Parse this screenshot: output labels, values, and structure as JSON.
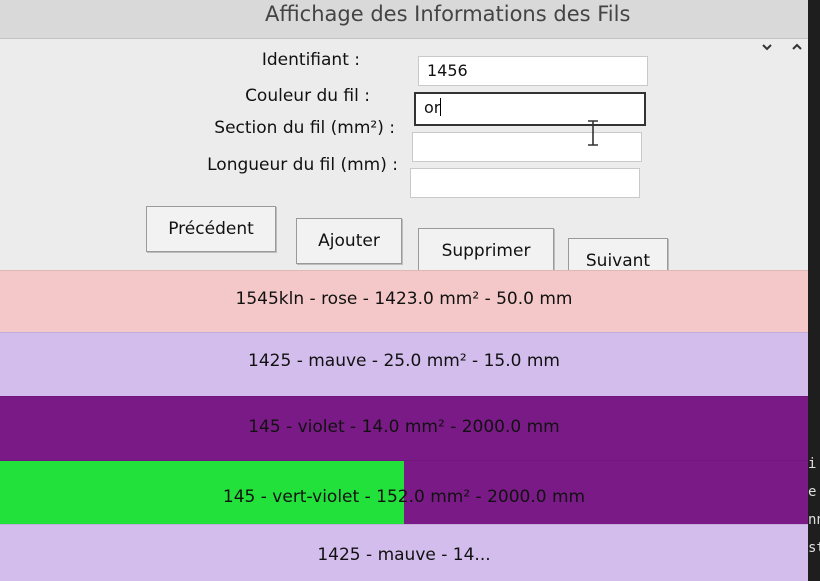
{
  "window": {
    "title": "Affichage des Informations des Fils",
    "controls": {
      "minimize_icon": "chevron-down-icon",
      "maximize_icon": "chevron-up-icon"
    }
  },
  "form": {
    "id_label": "Identifiant :",
    "id_value": "1456",
    "color_label": "Couleur du fil :",
    "color_value": "or",
    "section_label": "Section du fil (mm²) :",
    "section_value": "",
    "length_label": "Longueur du fil (mm) :",
    "length_value": ""
  },
  "buttons": {
    "previous": "Précédent",
    "add": "Ajouter",
    "delete": "Supprimer",
    "next": "Suivant"
  },
  "wires": [
    {
      "text": "1545kln - rose - 1423.0 mm² - 50.0 mm",
      "color": "#f4c8c8",
      "text_color": "#111111"
    },
    {
      "text": "1425 - mauve - 25.0 mm² - 15.0 mm",
      "color": "#d3bdec",
      "text_color": "#111111"
    },
    {
      "text": "145 - violet - 14.0 mm² - 2000.0 mm",
      "color": "#7a1a86",
      "text_color": "#111111"
    },
    {
      "text": "145 - vert-violet - 152.0 mm² - 2000.0 mm",
      "color": "#7a1a86",
      "split_color": "#22e13b",
      "split_fraction": 0.5,
      "text_color": "#111111"
    },
    {
      "text": "1425 - mauve - 14...",
      "color": "#d3bdec",
      "text_color": "#111111"
    }
  ],
  "terminal": {
    "lines": [
      "i",
      "e",
      "nn",
      "st"
    ]
  }
}
